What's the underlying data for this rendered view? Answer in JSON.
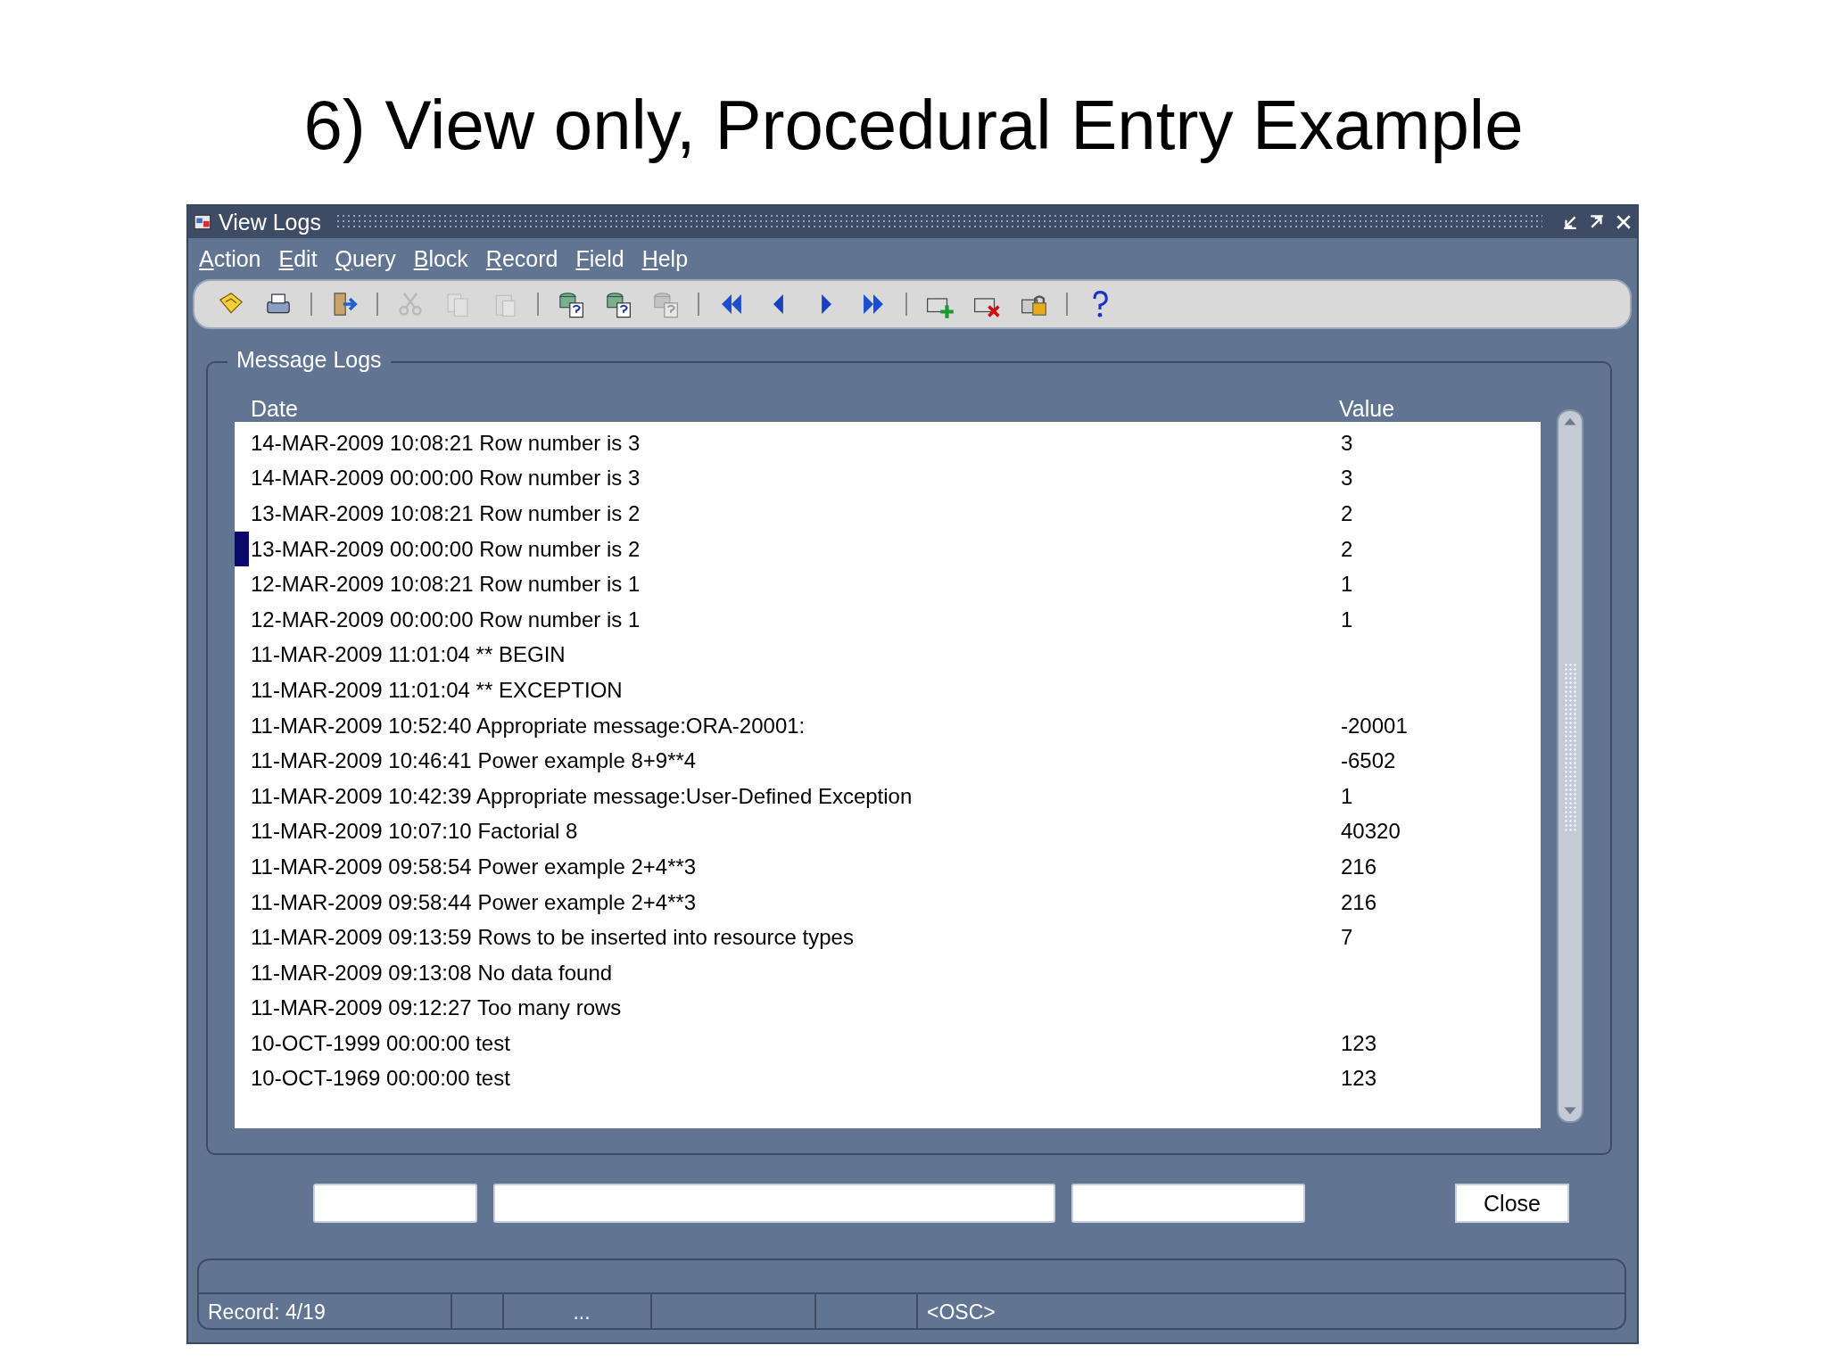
{
  "slide_title": "6) View only, Procedural Entry Example",
  "window": {
    "title": "View Logs"
  },
  "menu": [
    "Action",
    "Edit",
    "Query",
    "Block",
    "Record",
    "Field",
    "Help"
  ],
  "toolbar": [
    {
      "kind": "save",
      "disabled": false
    },
    {
      "kind": "print",
      "disabled": false
    },
    {
      "kind": "separator"
    },
    {
      "kind": "exit",
      "disabled": false
    },
    {
      "kind": "separator"
    },
    {
      "kind": "cut",
      "disabled": true
    },
    {
      "kind": "copy",
      "disabled": true
    },
    {
      "kind": "paste",
      "disabled": true
    },
    {
      "kind": "separator"
    },
    {
      "kind": "query",
      "disabled": false
    },
    {
      "kind": "query",
      "disabled": false
    },
    {
      "kind": "query",
      "disabled": true
    },
    {
      "kind": "separator"
    },
    {
      "kind": "first",
      "disabled": false
    },
    {
      "kind": "prev",
      "disabled": false
    },
    {
      "kind": "next",
      "disabled": false
    },
    {
      "kind": "last",
      "disabled": false
    },
    {
      "kind": "separator"
    },
    {
      "kind": "insert",
      "disabled": false
    },
    {
      "kind": "delete",
      "disabled": false
    },
    {
      "kind": "lock",
      "disabled": false
    },
    {
      "kind": "separator"
    },
    {
      "kind": "help",
      "disabled": false
    }
  ],
  "frame": {
    "title": "Message Logs"
  },
  "table": {
    "columns": [
      "Date",
      "Value"
    ],
    "rows": [
      {
        "message": "14-MAR-2009 10:08:21 Row number is 3",
        "value": "3",
        "selected": false
      },
      {
        "message": "14-MAR-2009 00:00:00 Row number is 3",
        "value": "3",
        "selected": false
      },
      {
        "message": "13-MAR-2009 10:08:21 Row number is 2",
        "value": "2",
        "selected": false
      },
      {
        "message": "13-MAR-2009 00:00:00 Row number is 2",
        "value": "2",
        "selected": true
      },
      {
        "message": "12-MAR-2009 10:08:21 Row number is 1",
        "value": "1",
        "selected": false
      },
      {
        "message": "12-MAR-2009 00:00:00 Row number is 1",
        "value": "1",
        "selected": false
      },
      {
        "message": "11-MAR-2009 11:01:04 ** BEGIN",
        "value": "",
        "selected": false
      },
      {
        "message": "11-MAR-2009 11:01:04 ** EXCEPTION",
        "value": "",
        "selected": false
      },
      {
        "message": "11-MAR-2009 10:52:40 Appropriate message:ORA-20001:",
        "value": "-20001",
        "selected": false
      },
      {
        "message": "11-MAR-2009 10:46:41 Power example 8+9**4",
        "value": "-6502",
        "selected": false
      },
      {
        "message": "11-MAR-2009 10:42:39 Appropriate message:User-Defined Exception",
        "value": "1",
        "selected": false
      },
      {
        "message": "11-MAR-2009 10:07:10 Factorial 8",
        "value": "40320",
        "selected": false
      },
      {
        "message": "11-MAR-2009 09:58:54 Power example 2+4**3",
        "value": "216",
        "selected": false
      },
      {
        "message": "11-MAR-2009 09:58:44 Power example 2+4**3",
        "value": "216",
        "selected": false
      },
      {
        "message": "11-MAR-2009 09:13:59 Rows to be inserted into resource types",
        "value": "7",
        "selected": false
      },
      {
        "message": "11-MAR-2009 09:13:08 No data found",
        "value": "",
        "selected": false
      },
      {
        "message": "11-MAR-2009 09:12:27 Too many rows",
        "value": "",
        "selected": false
      },
      {
        "message": "10-OCT-1999 00:00:00 test",
        "value": "123",
        "selected": false
      },
      {
        "message": "10-OCT-1969 00:00:00 test",
        "value": "123",
        "selected": false
      }
    ]
  },
  "buttons": [
    "Close"
  ],
  "status_bar": {
    "record": "Record: 4/19",
    "ellipsis": "...",
    "mode": "<OSC>"
  }
}
